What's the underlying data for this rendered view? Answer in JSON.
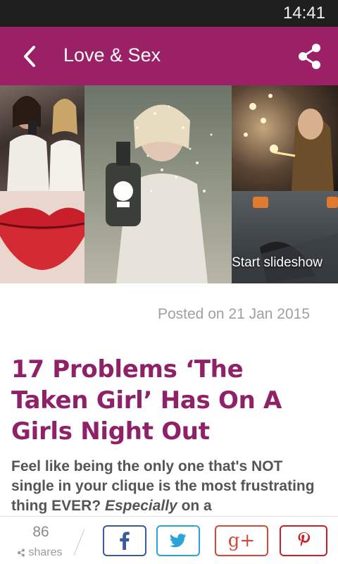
{
  "status_bar": {
    "time": "14:41"
  },
  "app_bar": {
    "title": "Love & Sex"
  },
  "hero": {
    "slideshow_label": "Start slideshow"
  },
  "article": {
    "posted": "Posted on 21 Jan 2015",
    "title": "17 Problems ‘The Taken Girl’ Has On A Girls Night Out",
    "intro_part1": "Feel like being the only one that's NOT single in your clique is the most frustrating thing EVER? ",
    "intro_emphasis": "Especially",
    "intro_part2": " on a"
  },
  "share_bar": {
    "count": "86",
    "label": "shares",
    "google_plus_label": "g+"
  },
  "colors": {
    "brand": "#9c2065",
    "headline": "#8e2167",
    "facebook": "#3b5998",
    "twitter": "#2aa3d8",
    "google_plus": "#d14836",
    "pinterest": "#cb2027"
  },
  "icons": [
    "back-arrow-icon",
    "share-icon",
    "facebook-icon",
    "twitter-icon",
    "google-plus-icon",
    "pinterest-icon",
    "share-small-icon"
  ]
}
